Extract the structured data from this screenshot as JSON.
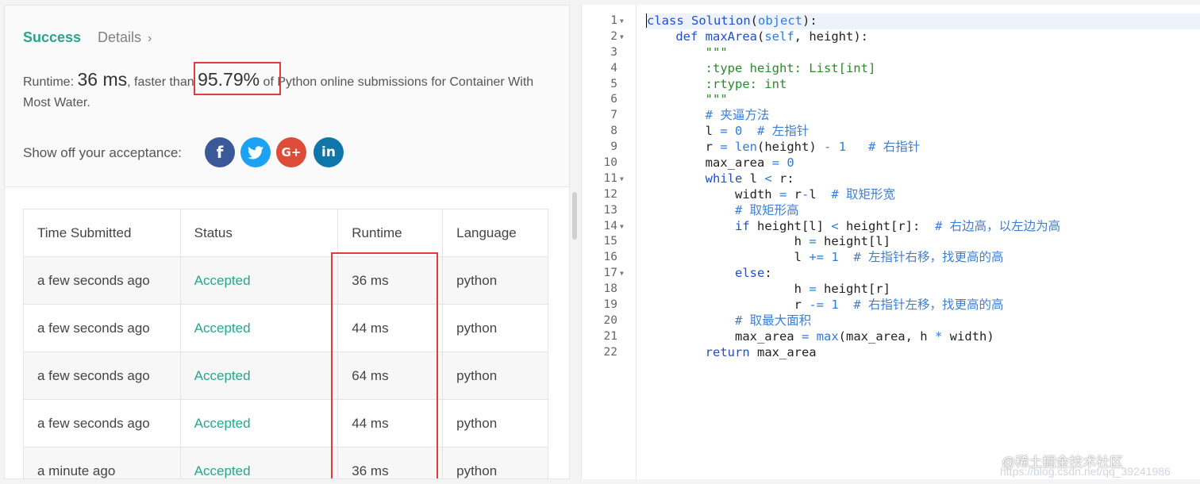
{
  "result": {
    "tabs": {
      "success": "Success",
      "details": "Details",
      "details_chevron": "›"
    },
    "runtime": {
      "label": "Runtime:",
      "value": "36 ms",
      "faster_text": ", faster than",
      "percent": "95.79%",
      "suffix": "of Python online submissions for Container With Most Water."
    },
    "acceptance_label": "Show off your acceptance:",
    "share_icons": [
      "facebook-icon",
      "twitter-icon",
      "google-plus-icon",
      "linkedin-icon"
    ],
    "share_glyphs": {
      "facebook": "f",
      "google": "G+",
      "linkedin": "in"
    },
    "highlight_color": "#e03c3c"
  },
  "table": {
    "headers": [
      "Time Submitted",
      "Status",
      "Runtime",
      "Language"
    ],
    "rows": [
      {
        "time": "a few seconds ago",
        "status": "Accepted",
        "runtime": "36 ms",
        "language": "python"
      },
      {
        "time": "a few seconds ago",
        "status": "Accepted",
        "runtime": "44 ms",
        "language": "python"
      },
      {
        "time": "a few seconds ago",
        "status": "Accepted",
        "runtime": "64 ms",
        "language": "python"
      },
      {
        "time": "a few seconds ago",
        "status": "Accepted",
        "runtime": "44 ms",
        "language": "python"
      },
      {
        "time": "a minute ago",
        "status": "Accepted",
        "runtime": "36 ms",
        "language": "python"
      }
    ]
  },
  "editor": {
    "lines": [
      {
        "n": "1",
        "fold": true,
        "tokens": [
          [
            "kw",
            "class"
          ],
          [
            "pl",
            " "
          ],
          [
            "fn",
            "Solution"
          ],
          [
            "pl",
            "("
          ],
          [
            "bi",
            "object"
          ],
          [
            "pl",
            "):"
          ]
        ]
      },
      {
        "n": "2",
        "fold": true,
        "tokens": [
          [
            "pl",
            "    "
          ],
          [
            "kw",
            "def"
          ],
          [
            "pl",
            " "
          ],
          [
            "fn",
            "maxArea"
          ],
          [
            "pl",
            "("
          ],
          [
            "bi",
            "self"
          ],
          [
            "pl",
            ", height):"
          ]
        ]
      },
      {
        "n": "3",
        "tokens": [
          [
            "pl",
            "        "
          ],
          [
            "str",
            "\"\"\""
          ]
        ]
      },
      {
        "n": "4",
        "tokens": [
          [
            "pl",
            "        "
          ],
          [
            "str",
            ":type height: List[int]"
          ]
        ]
      },
      {
        "n": "5",
        "tokens": [
          [
            "pl",
            "        "
          ],
          [
            "str",
            ":rtype: int"
          ]
        ]
      },
      {
        "n": "6",
        "tokens": [
          [
            "pl",
            "        "
          ],
          [
            "str",
            "\"\"\""
          ]
        ]
      },
      {
        "n": "7",
        "tokens": [
          [
            "pl",
            "        "
          ],
          [
            "cm",
            "# 夹逼方法"
          ]
        ]
      },
      {
        "n": "8",
        "tokens": [
          [
            "pl",
            "        l "
          ],
          [
            "op",
            "="
          ],
          [
            "pl",
            " "
          ],
          [
            "op",
            "0"
          ],
          [
            "pl",
            "  "
          ],
          [
            "cm",
            "# 左指针"
          ]
        ]
      },
      {
        "n": "9",
        "tokens": [
          [
            "pl",
            "        r "
          ],
          [
            "op",
            "="
          ],
          [
            "pl",
            " "
          ],
          [
            "bi",
            "len"
          ],
          [
            "pl",
            "(height) "
          ],
          [
            "op",
            "-"
          ],
          [
            "pl",
            " "
          ],
          [
            "op",
            "1"
          ],
          [
            "pl",
            "   "
          ],
          [
            "cm",
            "# 右指针"
          ]
        ]
      },
      {
        "n": "10",
        "tokens": [
          [
            "pl",
            "        max_area "
          ],
          [
            "op",
            "="
          ],
          [
            "pl",
            " "
          ],
          [
            "op",
            "0"
          ]
        ]
      },
      {
        "n": "11",
        "fold": true,
        "tokens": [
          [
            "pl",
            "        "
          ],
          [
            "kw",
            "while"
          ],
          [
            "pl",
            " l "
          ],
          [
            "op",
            "<"
          ],
          [
            "pl",
            " r:"
          ]
        ]
      },
      {
        "n": "12",
        "tokens": [
          [
            "pl",
            "            width "
          ],
          [
            "op",
            "="
          ],
          [
            "pl",
            " r"
          ],
          [
            "op",
            "-"
          ],
          [
            "pl",
            "l  "
          ],
          [
            "cm",
            "# 取矩形宽"
          ]
        ]
      },
      {
        "n": "13",
        "tokens": [
          [
            "pl",
            "            "
          ],
          [
            "cm",
            "# 取矩形高"
          ]
        ]
      },
      {
        "n": "14",
        "fold": true,
        "tokens": [
          [
            "pl",
            "            "
          ],
          [
            "kw",
            "if"
          ],
          [
            "pl",
            " height[l] "
          ],
          [
            "op",
            "<"
          ],
          [
            "pl",
            " height[r]:  "
          ],
          [
            "cm",
            "# 右边高，以左边为高"
          ]
        ]
      },
      {
        "n": "15",
        "tokens": [
          [
            "pl",
            "                    h "
          ],
          [
            "op",
            "="
          ],
          [
            "pl",
            " height[l]"
          ]
        ]
      },
      {
        "n": "16",
        "tokens": [
          [
            "pl",
            "                    l "
          ],
          [
            "op",
            "+="
          ],
          [
            "pl",
            " "
          ],
          [
            "op",
            "1"
          ],
          [
            "pl",
            "  "
          ],
          [
            "cm",
            "# 左指针右移，找更高的高"
          ]
        ]
      },
      {
        "n": "17",
        "fold": true,
        "tokens": [
          [
            "pl",
            "            "
          ],
          [
            "kw",
            "else"
          ],
          [
            "pl",
            ":"
          ]
        ]
      },
      {
        "n": "18",
        "tokens": [
          [
            "pl",
            "                    h "
          ],
          [
            "op",
            "="
          ],
          [
            "pl",
            " height[r]"
          ]
        ]
      },
      {
        "n": "19",
        "tokens": [
          [
            "pl",
            "                    r "
          ],
          [
            "op",
            "-="
          ],
          [
            "pl",
            " "
          ],
          [
            "op",
            "1"
          ],
          [
            "pl",
            "  "
          ],
          [
            "cm",
            "# 右指针左移，找更高的高"
          ]
        ]
      },
      {
        "n": "20",
        "tokens": [
          [
            "pl",
            "            "
          ],
          [
            "cm",
            "# 取最大面积"
          ]
        ]
      },
      {
        "n": "21",
        "tokens": [
          [
            "pl",
            "            max_area "
          ],
          [
            "op",
            "="
          ],
          [
            "pl",
            " "
          ],
          [
            "bi",
            "max"
          ],
          [
            "pl",
            "(max_area, h "
          ],
          [
            "op",
            "*"
          ],
          [
            "pl",
            " width)"
          ]
        ]
      },
      {
        "n": "22",
        "tokens": [
          [
            "pl",
            "        "
          ],
          [
            "kw",
            "return"
          ],
          [
            "pl",
            " max_area"
          ]
        ]
      }
    ]
  },
  "watermark": {
    "text": "@稀土掘金技术社区",
    "url": "https://blog.csdn.net/qq_39241986"
  }
}
